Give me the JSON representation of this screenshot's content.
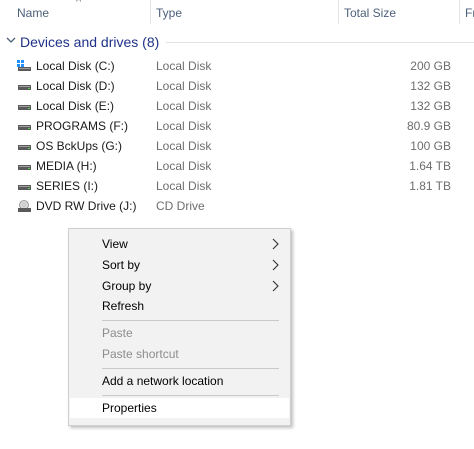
{
  "columns": {
    "name": "Name",
    "type": "Type",
    "total_size": "Total Size",
    "partial": "Fr"
  },
  "group": {
    "title": "Devices and drives (8)"
  },
  "drives": [
    {
      "name": "Local Disk (C:)",
      "type": "Local Disk",
      "size": "200 GB",
      "icon": "windows-drive-icon"
    },
    {
      "name": "Local Disk (D:)",
      "type": "Local Disk",
      "size": "132 GB",
      "icon": "hard-drive-icon"
    },
    {
      "name": "Local Disk (E:)",
      "type": "Local Disk",
      "size": "132 GB",
      "icon": "hard-drive-icon"
    },
    {
      "name": "PROGRAMS (F:)",
      "type": "Local Disk",
      "size": "80.9 GB",
      "icon": "hard-drive-icon"
    },
    {
      "name": "OS BckUps (G:)",
      "type": "Local Disk",
      "size": "100 GB",
      "icon": "hard-drive-icon"
    },
    {
      "name": "MEDIA (H:)",
      "type": "Local Disk",
      "size": "1.64 TB",
      "icon": "hard-drive-icon"
    },
    {
      "name": "SERIES (I:)",
      "type": "Local Disk",
      "size": "1.81 TB",
      "icon": "hard-drive-icon"
    },
    {
      "name": "DVD RW Drive (J:)",
      "type": "CD Drive",
      "size": "",
      "icon": "dvd-drive-icon"
    }
  ],
  "context_menu": {
    "view": "View",
    "sort_by": "Sort by",
    "group_by": "Group by",
    "refresh": "Refresh",
    "paste": "Paste",
    "paste_shortcut": "Paste shortcut",
    "add_network_location": "Add a network location",
    "properties": "Properties"
  },
  "colors": {
    "group_title": "#1e3287",
    "column_header": "#4c607a",
    "menu_bg": "#f2f2f2",
    "disabled_text": "#8d8d8d"
  }
}
